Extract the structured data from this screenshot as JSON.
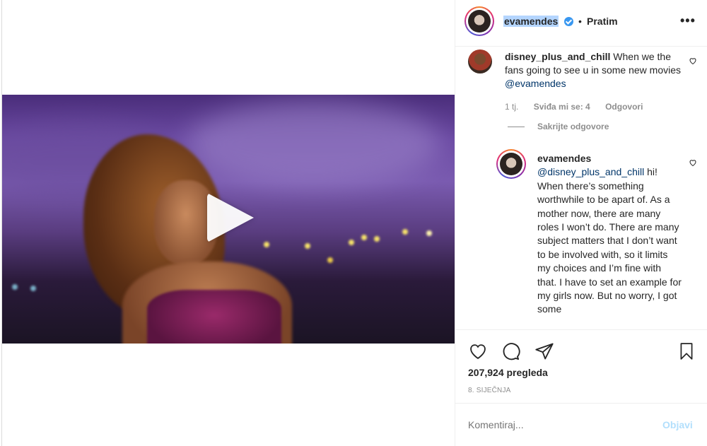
{
  "header": {
    "username": "evamendes",
    "separator": "•",
    "follow_label": "Pratim",
    "more_label": "•••"
  },
  "comment": {
    "username": "disney_plus_and_chill",
    "text": " When we the fans going to see u in some new movies ",
    "mention": "@evamendes",
    "time": "1 tj.",
    "likes": "Sviđa mi se: 4",
    "reply_label": "Odgovori",
    "hide_replies": "Sakrijte odgovore"
  },
  "reply": {
    "username": "evamendes",
    "mention": "@disney_plus_and_chill",
    "text": " hi! When there’s something worthwhile to be apart of. As a mother now, there are many roles I won’t do. There are many subject matters that I don’t want to be involved with, so it limits my choices and I’m fine with that. I have to set an example for my girls now. But no worry, I got some"
  },
  "post": {
    "views": "207,924 pregleda",
    "date": "8. SIJEČNJA",
    "comment_placeholder": "Komentiraj...",
    "post_label": "Objavi"
  },
  "icons": {
    "play": "play-icon",
    "like": "heart-icon",
    "comment": "comment-icon",
    "share": "paper-plane-icon",
    "save": "bookmark-icon",
    "verified": "verified-badge-icon"
  },
  "colors": {
    "verified": "#3897f0",
    "mention": "#003569",
    "muted": "#8e8e8e",
    "post_disabled": "#b2dffc",
    "selection": "#b4d5fe"
  }
}
